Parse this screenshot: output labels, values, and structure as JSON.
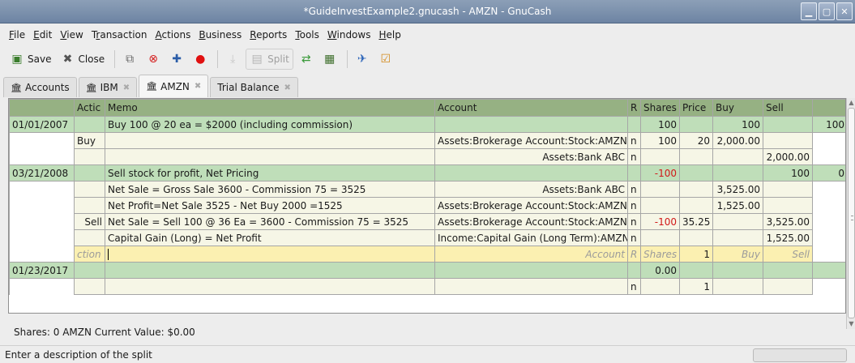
{
  "window": {
    "title": "*GuideInvestExample2.gnucash - AMZN - GnuCash"
  },
  "menu": [
    "File",
    "Edit",
    "View",
    "Transaction",
    "Actions",
    "Business",
    "Reports",
    "Tools",
    "Windows",
    "Help"
  ],
  "toolbar": {
    "save": "Save",
    "close": "Close",
    "split": "Split"
  },
  "tabs": [
    {
      "label": "Accounts"
    },
    {
      "label": "IBM"
    },
    {
      "label": "AMZN"
    },
    {
      "label": "Trial Balance"
    }
  ],
  "register": {
    "headers": {
      "date": "",
      "action": "Actic",
      "memo": "Memo",
      "account": "Account",
      "r": "R",
      "shares": "Shares",
      "price": "Price",
      "buy": "Buy",
      "sell": "Sell",
      "balance": ""
    },
    "rows": [
      {
        "date": "01/01/2007",
        "memo": "Buy 100 @ 20 ea = $2000 (including commission)",
        "shares": "100",
        "buy": "100",
        "balance": "100"
      },
      {
        "action": "Buy",
        "account": "Assets:Brokerage Account:Stock:AMZN",
        "r": "n",
        "shares": "100",
        "price": "20",
        "buy": "2,000.00"
      },
      {
        "account": "Assets:Bank ABC",
        "r": "n",
        "sell": "2,000.00"
      },
      {
        "date": "03/21/2008",
        "memo": "Sell stock for profit, Net Pricing",
        "shares": "-100",
        "sell": "100",
        "balance": "0"
      },
      {
        "memo": "Net Sale = Gross Sale 3600 - Commission 75 = 3525",
        "account": "Assets:Bank ABC",
        "r": "n",
        "buy": "3,525.00"
      },
      {
        "memo": "Net Profit=Net Sale 3525 - Net Buy 2000 =1525",
        "account": "Assets:Brokerage Account:Stock:AMZN",
        "r": "n",
        "buy": "1,525.00"
      },
      {
        "action": "Sell",
        "memo": "Net Sale = Sell 100 @ 36 Ea = 3600 - Commission 75 = 3525",
        "account": "Assets:Brokerage Account:Stock:AMZN",
        "r": "n",
        "shares": "-100",
        "price": "35.25",
        "sell": "3,525.00"
      },
      {
        "memo": "Capital Gain (Long) = Net Profit",
        "account": "Income:Capital Gain (Long Term):AMZN",
        "r": "n",
        "sell": "1,525.00"
      },
      {
        "action": "ction",
        "account": "Account",
        "r": "R",
        "shares": "Shares",
        "price": "1",
        "buy": "Buy",
        "sell": "Sell"
      },
      {
        "date": "01/23/2017",
        "shares": "0.00"
      },
      {
        "r": "n",
        "price": "1"
      }
    ]
  },
  "summary": "Shares: 0 AMZN   Current Value: $0.00",
  "status": "Enter a description of the split"
}
